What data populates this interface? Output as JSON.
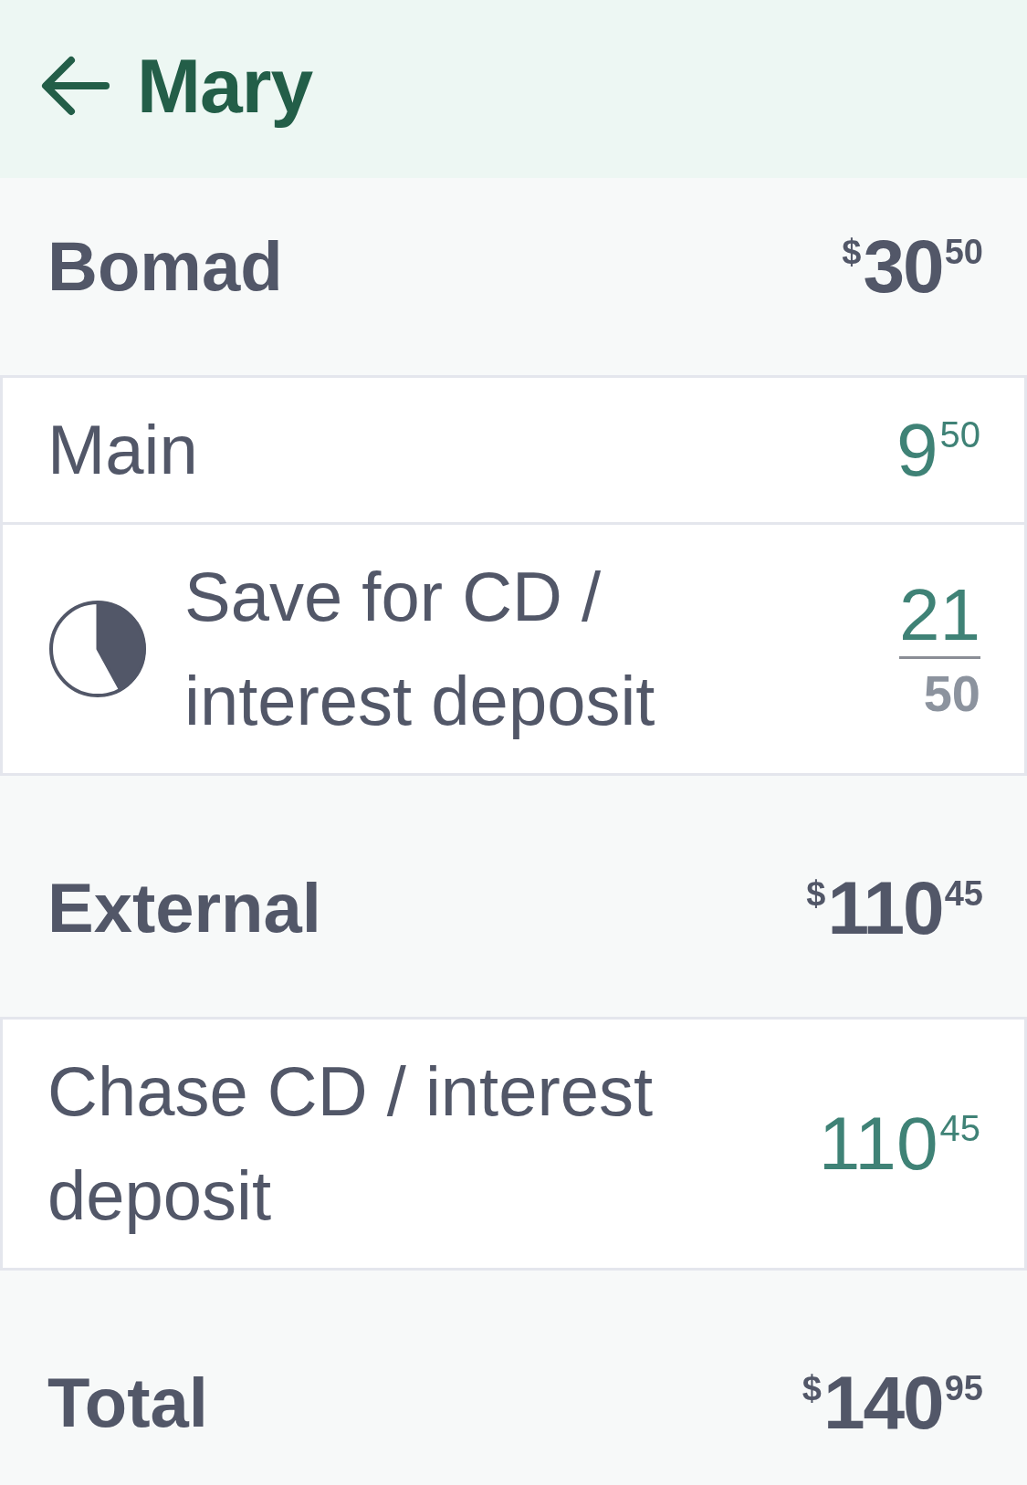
{
  "header": {
    "title": "Mary"
  },
  "sections": [
    {
      "title": "Bomad",
      "total": {
        "currency": "$",
        "whole": "30",
        "cents": "50"
      },
      "accounts": [
        {
          "kind": "balance",
          "name": "Main",
          "amount": {
            "whole": "9",
            "cents": "50"
          }
        },
        {
          "kind": "goal",
          "name": "Save for CD / interest deposit",
          "level": 0.42,
          "saved": "21",
          "goal": "50"
        }
      ]
    },
    {
      "title": "External",
      "total": {
        "currency": "$",
        "whole": "110",
        "cents": "45"
      },
      "accounts": [
        {
          "kind": "balance",
          "name": "Chase CD / interest deposit",
          "amount": {
            "whole": "110",
            "cents": "45"
          }
        }
      ]
    }
  ],
  "total": {
    "label": "Total",
    "amount": {
      "currency": "$",
      "whole": "140",
      "cents": "95"
    }
  }
}
